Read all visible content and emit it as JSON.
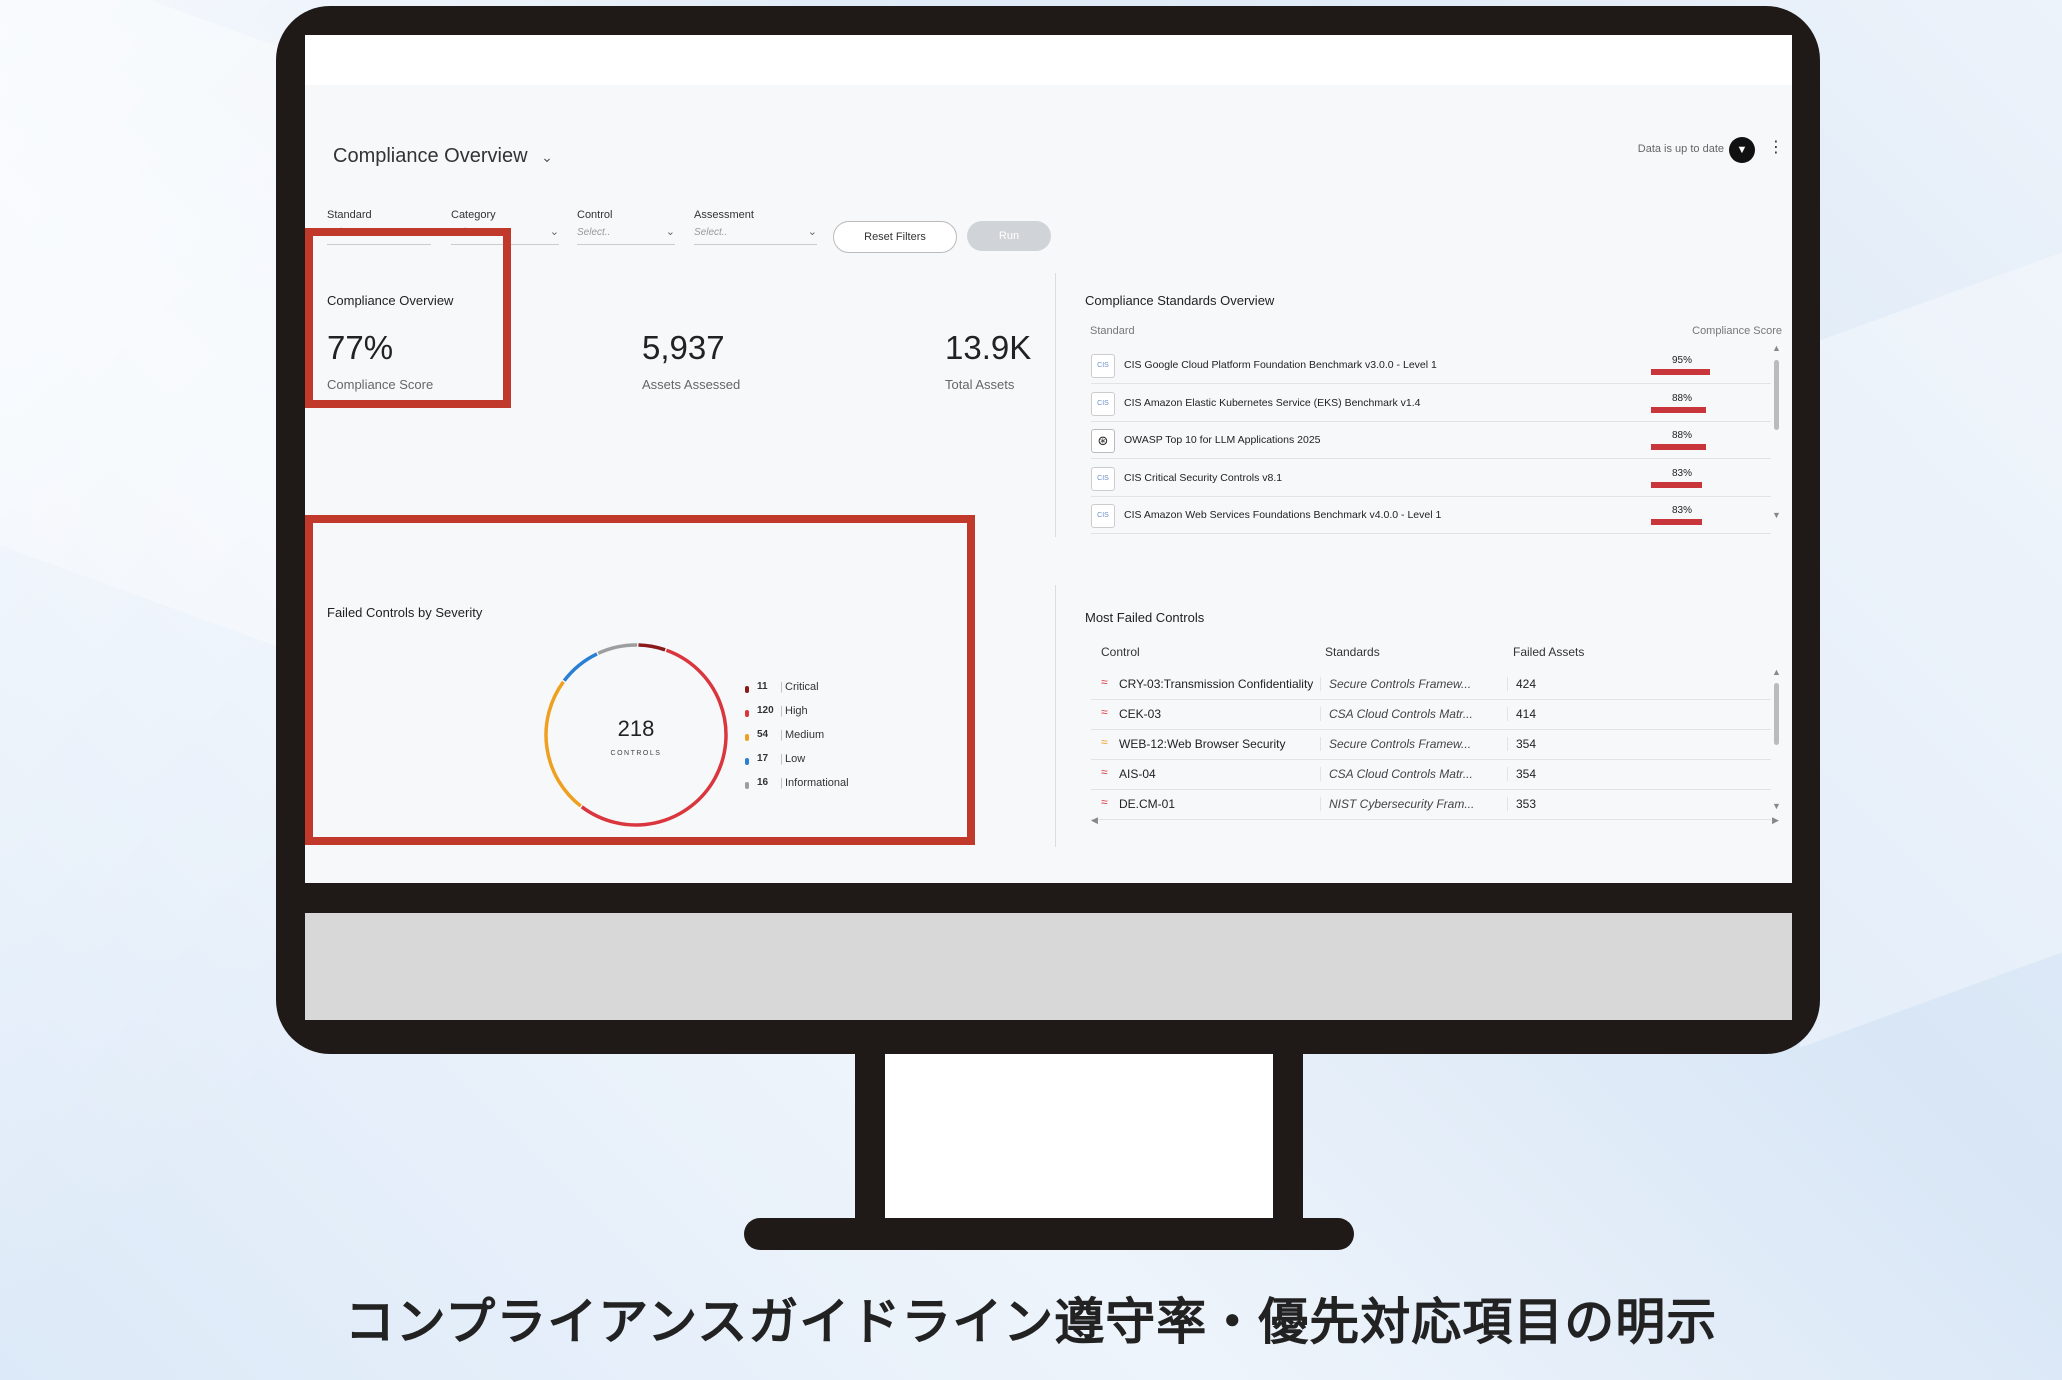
{
  "caption": "コンプライアンスガイドライン遵守率・優先対応項目の明示",
  "header": {
    "page_title": "Compliance Overview",
    "data_status": "Data is up to date"
  },
  "filters": [
    {
      "label": "Standard",
      "placeholder": "Select.."
    },
    {
      "label": "Category",
      "placeholder": "Select.."
    },
    {
      "label": "Control",
      "placeholder": "Select.."
    },
    {
      "label": "Assessment",
      "placeholder": "Select.."
    }
  ],
  "buttons": {
    "reset": "Reset Filters",
    "run": "Run"
  },
  "overview": {
    "title": "Compliance Overview",
    "score_value": "77%",
    "score_label": "Compliance Score",
    "assets_assessed_value": "5,937",
    "assets_assessed_label": "Assets Assessed",
    "total_assets_value": "13.9K",
    "total_assets_label": "Total Assets"
  },
  "standards_overview": {
    "title": "Compliance Standards Overview",
    "col_standard": "Standard",
    "col_score": "Compliance Score",
    "rows": [
      {
        "name": "CIS Google Cloud Platform Foundation Benchmark v3.0.0 - Level 1",
        "score": "95%",
        "pct": 95,
        "icon": "cis"
      },
      {
        "name": "CIS Amazon Elastic Kubernetes Service (EKS) Benchmark v1.4",
        "score": "88%",
        "pct": 88,
        "icon": "cis"
      },
      {
        "name": "OWASP Top 10 for LLM Applications 2025",
        "score": "88%",
        "pct": 88,
        "icon": "owasp"
      },
      {
        "name": "CIS Critical Security Controls v8.1",
        "score": "83%",
        "pct": 83,
        "icon": "cis"
      },
      {
        "name": "CIS Amazon Web Services Foundations Benchmark v4.0.0 - Level 1",
        "score": "83%",
        "pct": 83,
        "icon": "cis"
      }
    ]
  },
  "failed_controls": {
    "title": "Failed Controls by Severity",
    "total": "218",
    "total_label": "CONTROLS",
    "severities": [
      {
        "name": "Critical",
        "count": 11,
        "color": "#8b1a1a"
      },
      {
        "name": "High",
        "count": 120,
        "color": "#d9363e"
      },
      {
        "name": "Medium",
        "count": 54,
        "color": "#f0a020"
      },
      {
        "name": "Low",
        "count": 17,
        "color": "#2a7fd4"
      },
      {
        "name": "Informational",
        "count": 16,
        "color": "#9e9e9e"
      }
    ]
  },
  "most_failed": {
    "title": "Most Failed Controls",
    "col_control": "Control",
    "col_standards": "Standards",
    "col_failed": "Failed Assets",
    "rows": [
      {
        "control": "CRY-03:Transmission Confidentiality",
        "standard": "Secure Controls Framew...",
        "failed": "424",
        "severity": "high"
      },
      {
        "control": "CEK-03",
        "standard": "CSA Cloud Controls Matr...",
        "failed": "414",
        "severity": "high"
      },
      {
        "control": "WEB-12:Web Browser Security",
        "standard": "Secure Controls Framew...",
        "failed": "354",
        "severity": "medium"
      },
      {
        "control": "AIS-04",
        "standard": "CSA Cloud Controls Matr...",
        "failed": "354",
        "severity": "high"
      },
      {
        "control": "DE.CM-01",
        "standard": "NIST Cybersecurity Fram...",
        "failed": "353",
        "severity": "high"
      }
    ]
  }
}
